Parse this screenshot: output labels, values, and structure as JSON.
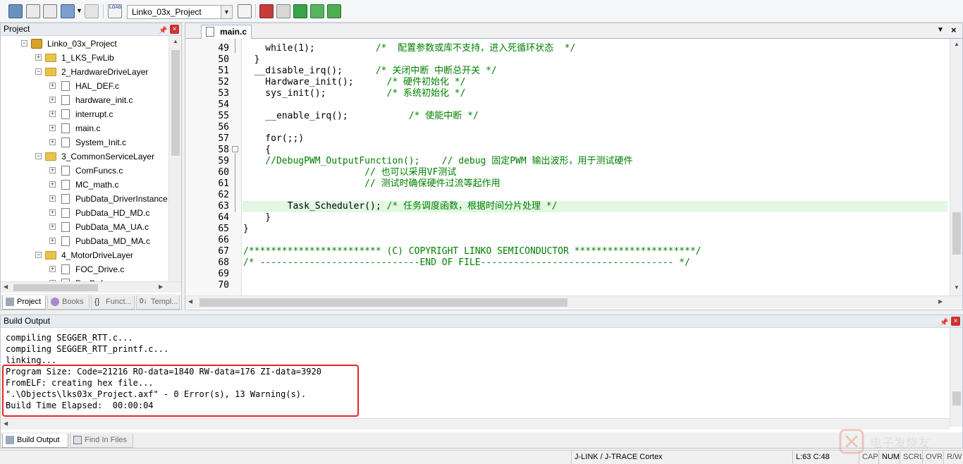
{
  "toolbar": {
    "target_value": "Linko_03x_Project",
    "load_label": "LOAD"
  },
  "project_panel": {
    "title": "Project",
    "root": "Linko_03x_Project",
    "items": [
      {
        "label": "1_LKS_FwLib",
        "type": "folder",
        "level": 1,
        "expander": "+"
      },
      {
        "label": "2_HardwareDriveLayer",
        "type": "folder",
        "level": 1,
        "expander": "−"
      },
      {
        "label": "HAL_DEF.c",
        "type": "file",
        "level": 2,
        "expander": "+"
      },
      {
        "label": "hardware_init.c",
        "type": "file",
        "level": 2,
        "expander": "+"
      },
      {
        "label": "interrupt.c",
        "type": "file",
        "level": 2,
        "expander": "+"
      },
      {
        "label": "main.c",
        "type": "file",
        "level": 2,
        "expander": "+"
      },
      {
        "label": "System_Init.c",
        "type": "file",
        "level": 2,
        "expander": "+"
      },
      {
        "label": "3_CommonServiceLayer",
        "type": "folder",
        "level": 1,
        "expander": "−"
      },
      {
        "label": "ComFuncs.c",
        "type": "file",
        "level": 2,
        "expander": "+"
      },
      {
        "label": "MC_math.c",
        "type": "file",
        "level": 2,
        "expander": "+"
      },
      {
        "label": "PubData_DriverInstance.c",
        "type": "file",
        "level": 2,
        "expander": "+"
      },
      {
        "label": "PubData_HD_MD.c",
        "type": "file",
        "level": 2,
        "expander": "+"
      },
      {
        "label": "PubData_MA_UA.c",
        "type": "file",
        "level": 2,
        "expander": "+"
      },
      {
        "label": "PubData_MD_MA.c",
        "type": "file",
        "level": 2,
        "expander": "+"
      },
      {
        "label": "4_MotorDriveLayer",
        "type": "folder",
        "level": 1,
        "expander": "−"
      },
      {
        "label": "FOC_Drive.c",
        "type": "file",
        "level": 2,
        "expander": "+"
      },
      {
        "label": "FaxDef...",
        "type": "file",
        "level": 2,
        "expander": "+"
      }
    ],
    "tabs": [
      "Project",
      "Books",
      "Funct...",
      "Templ..."
    ]
  },
  "editor": {
    "active_tab": "main.c",
    "lines": [
      {
        "n": "49",
        "code": "    while(1);           /*  配置参数或库不支持，进入死循环状态  */"
      },
      {
        "n": "50",
        "code": "  }"
      },
      {
        "n": "51",
        "code": "  __disable_irq();      /* 关闭中断 中断总开关 */"
      },
      {
        "n": "52",
        "code": "    Hardware_init();      /* 硬件初始化 */"
      },
      {
        "n": "53",
        "code": "    sys_init();           /* 系统初始化 */"
      },
      {
        "n": "54",
        "code": ""
      },
      {
        "n": "55",
        "code": "    __enable_irq();           /* 使能中断 */"
      },
      {
        "n": "56",
        "code": ""
      },
      {
        "n": "57",
        "code": "    for(;;)"
      },
      {
        "n": "58",
        "code": "    {"
      },
      {
        "n": "59",
        "code": "    //DebugPWM_OutputFunction();    // debug 固定PWM 输出波形，用于测试硬件"
      },
      {
        "n": "60",
        "code": "                      // 也可以采用VF测试"
      },
      {
        "n": "61",
        "code": "                      // 测试时确保硬件过流等起作用"
      },
      {
        "n": "62",
        "code": ""
      },
      {
        "n": "63",
        "code": "        Task_Scheduler(); /* 任务调度函数，根据时间分片处理 */"
      },
      {
        "n": "64",
        "code": "    }"
      },
      {
        "n": "65",
        "code": "}"
      },
      {
        "n": "66",
        "code": ""
      },
      {
        "n": "67",
        "code": "/************************ (C) COPYRIGHT LINKO SEMICONDUCTOR **********************/"
      },
      {
        "n": "68",
        "code": "/* -----------------------------END OF FILE----------------------------------- */"
      },
      {
        "n": "69",
        "code": ""
      },
      {
        "n": "70",
        "code": ""
      }
    ]
  },
  "build_output": {
    "title": "Build Output",
    "lines": [
      "compiling SEGGER_RTT.c...",
      "compiling SEGGER_RTT_printf.c...",
      "linking...",
      "Program Size: Code=21216 RO-data=1840 RW-data=176 ZI-data=3920",
      "FromELF: creating hex file...",
      "\".\\Objects\\lks03x_Project.axf\" - 0 Error(s), 13 Warning(s).",
      "Build Time Elapsed:  00:00:04"
    ],
    "tabs": [
      "Build Output",
      "Find In Files"
    ]
  },
  "status_bar": {
    "debugger": "J-LINK / J-TRACE Cortex",
    "position": "L:63 C:48",
    "cap": "CAP",
    "num": "NUM",
    "scrl": "SCRL",
    "ovr": "OVR",
    "rw": "R/W"
  },
  "watermark": {
    "text": "电子发烧友"
  },
  "colors": {
    "comment": "#008000",
    "highlight": "#e2f8e2",
    "error_box": "#e32626"
  }
}
